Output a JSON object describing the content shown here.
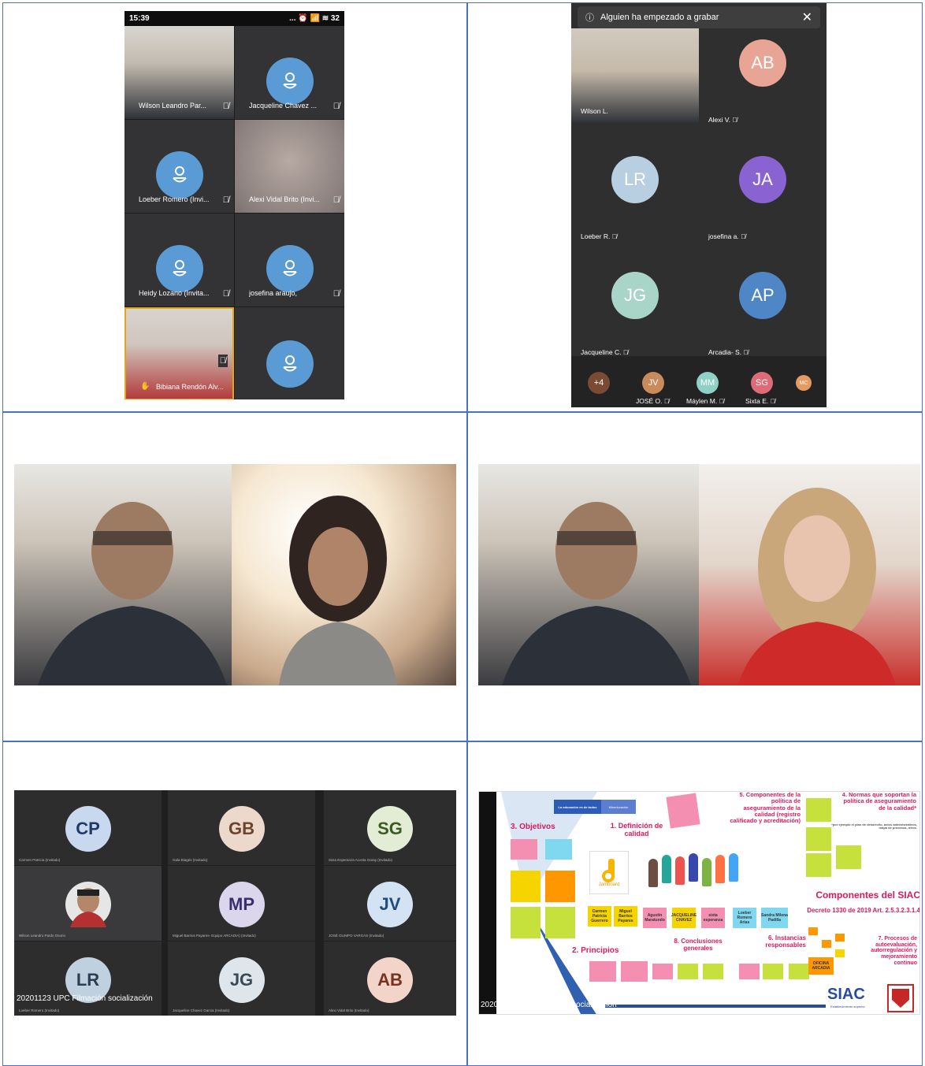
{
  "phone1": {
    "time": "15:39",
    "status_icons": "... ⏰ 📶 ≋ 32",
    "tiles": [
      {
        "name": "Wilson Leandro Par..."
      },
      {
        "name": "Jacqueline Chavez ..."
      },
      {
        "name": "Loeber Romero (Invi..."
      },
      {
        "name": "Alexi Vidal Brito (Invi..."
      },
      {
        "name": "Heidy Lozano (Invita..."
      },
      {
        "name": "josefina araujo,"
      },
      {
        "name": "Bibiana Rendón Alv..."
      },
      {
        "name": ""
      }
    ]
  },
  "phone2": {
    "banner": "Alguien ha empezado a grabar",
    "tiles": [
      {
        "name": "Wilson L."
      },
      {
        "initials": "AB",
        "name": "Alexi V.",
        "color": "#e8a595"
      },
      {
        "initials": "LR",
        "name": "Loeber R.",
        "color": "#b7cfe0"
      },
      {
        "initials": "JA",
        "name": "josefina a.",
        "color": "#8a63d2"
      },
      {
        "initials": "JG",
        "name": "Jacqueline C.",
        "color": "#a9d5c9"
      },
      {
        "initials": "AP",
        "name": "Arcadia- S.",
        "color": "#4e86c6"
      }
    ],
    "bottom": [
      {
        "initials": "+4",
        "name": "",
        "color": "#7a4a35"
      },
      {
        "initials": "JV",
        "name": "JOSÉ O.",
        "color": "#c98b5b"
      },
      {
        "initials": "MM",
        "name": "Máylen M.",
        "color": "#8fd1c6"
      },
      {
        "initials": "SG",
        "name": "Sixta E.",
        "color": "#e06b78"
      },
      {
        "initials": "MC",
        "name": "",
        "color": "#e39b63"
      }
    ]
  },
  "teams": {
    "tiles": [
      {
        "initials": "CP",
        "name": "Carmen Patricia (Invitado)",
        "bg": "#c8d8ef",
        "fg": "#1f3a68"
      },
      {
        "initials": "GB",
        "name": "Gala Biagés (Invitado)",
        "bg": "#ecd9cc",
        "fg": "#6b4430"
      },
      {
        "initials": "SG",
        "name": "Sixta Esperanza Acosta Garay (Invitado)",
        "bg": "#e3ecd4",
        "fg": "#3b5a24"
      },
      {
        "initials": "",
        "name": "Wilson Leandro Pardo Osorio",
        "bg": "",
        "fg": ""
      },
      {
        "initials": "MP",
        "name": "Miguel Barrios Payares- Equipo ARCADIA) (Invitado)",
        "bg": "#dcd6ec",
        "fg": "#3b2f6b"
      },
      {
        "initials": "JV",
        "name": "JOSÉ OLIMPO VARGAS (Invitado)",
        "bg": "#d4e3f3",
        "fg": "#1f4d7a"
      },
      {
        "initials": "LR",
        "name": "Loeber Romero (Invitado)",
        "bg": "#bfd0df",
        "fg": "#2b3f52"
      },
      {
        "initials": "JG",
        "name": "Jacqueline Chavez Garcia (Invitado)",
        "bg": "#dfe6eb",
        "fg": "#3a4a55"
      },
      {
        "initials": "AB",
        "name": "Alexi Vidal Brito (Invitado)",
        "bg": "#f3d4c9",
        "fg": "#7a3320"
      }
    ],
    "caption": "20201123 UPC Filmación socialización"
  },
  "slide": {
    "caption": "20201123 UPC Filmación socialización",
    "header_logo": "La educación es de todos",
    "header_ministry": "Mineducación",
    "h3": "3. Objetivos",
    "h1": "1. Definición de calidad",
    "h5": "5. Componentes de la política de aseguramiento de la calidad (registro calificado y acreditación)",
    "h4": "4. Normas que soportan la política de aseguramiento de la calidad*",
    "h4_note": "*por ejemplo el plan de desarrollo, actos administrativos, mapa de procesos, otros.",
    "components_title": "Componentes del SIAC",
    "decree": "Decreto 1330 de 2019 Art. 2.5.3.2.3.1.4",
    "h2": "2. Principios",
    "h8": "8. Conclusiones generales",
    "h6": "6. Instancias responsables",
    "h7": "7. Procesos de autoevaluación, autorregulación y mejoramiento continuo",
    "jamboard": "Jamboard",
    "siac": "SIAC",
    "siac_sub": "Establecimiento superior",
    "oficina": "OFICINA ARCADIA",
    "names": [
      "Carmen Patricia Guerrero",
      "Miguel Barrios Payares",
      "Agustín Maratundo",
      "JACQUELINE CHAVEZ",
      "sixta esperanza",
      "Loeber Romero Arias",
      "Sandra Milena Padilla"
    ]
  },
  "colors": {
    "border": "#4a72c4",
    "pink": "#d81b60"
  }
}
